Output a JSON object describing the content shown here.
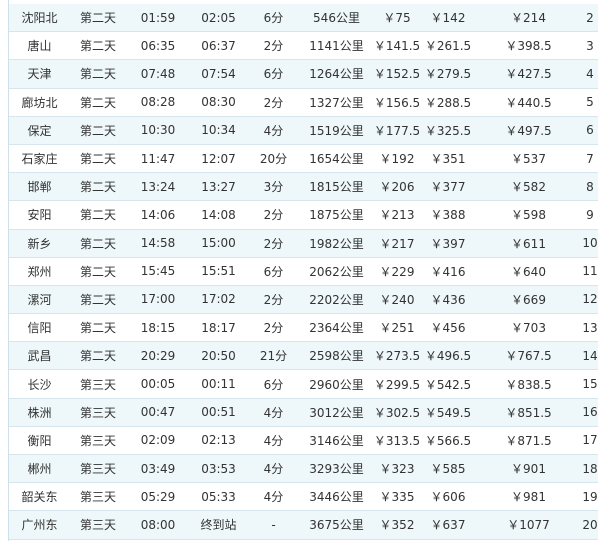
{
  "rows": [
    {
      "station": "沈阳北",
      "day": "第二天",
      "arrive": "01:59",
      "depart": "02:05",
      "stop": "6分",
      "distance": "546公里",
      "fare1": "￥75",
      "fare2": "￥142",
      "fare3": "￥214",
      "no": "2"
    },
    {
      "station": "唐山",
      "day": "第二天",
      "arrive": "06:35",
      "depart": "06:37",
      "stop": "2分",
      "distance": "1141公里",
      "fare1": "￥141.5",
      "fare2": "￥261.5",
      "fare3": "￥398.5",
      "no": "3"
    },
    {
      "station": "天津",
      "day": "第二天",
      "arrive": "07:48",
      "depart": "07:54",
      "stop": "6分",
      "distance": "1264公里",
      "fare1": "￥152.5",
      "fare2": "￥279.5",
      "fare3": "￥427.5",
      "no": "4"
    },
    {
      "station": "廊坊北",
      "day": "第二天",
      "arrive": "08:28",
      "depart": "08:30",
      "stop": "2分",
      "distance": "1327公里",
      "fare1": "￥156.5",
      "fare2": "￥288.5",
      "fare3": "￥440.5",
      "no": "5"
    },
    {
      "station": "保定",
      "day": "第二天",
      "arrive": "10:30",
      "depart": "10:34",
      "stop": "4分",
      "distance": "1519公里",
      "fare1": "￥177.5",
      "fare2": "￥325.5",
      "fare3": "￥497.5",
      "no": "6"
    },
    {
      "station": "石家庄",
      "day": "第二天",
      "arrive": "11:47",
      "depart": "12:07",
      "stop": "20分",
      "distance": "1654公里",
      "fare1": "￥192",
      "fare2": "￥351",
      "fare3": "￥537",
      "no": "7"
    },
    {
      "station": "邯郸",
      "day": "第二天",
      "arrive": "13:24",
      "depart": "13:27",
      "stop": "3分",
      "distance": "1815公里",
      "fare1": "￥206",
      "fare2": "￥377",
      "fare3": "￥582",
      "no": "8"
    },
    {
      "station": "安阳",
      "day": "第二天",
      "arrive": "14:06",
      "depart": "14:08",
      "stop": "2分",
      "distance": "1875公里",
      "fare1": "￥213",
      "fare2": "￥388",
      "fare3": "￥598",
      "no": "9"
    },
    {
      "station": "新乡",
      "day": "第二天",
      "arrive": "14:58",
      "depart": "15:00",
      "stop": "2分",
      "distance": "1982公里",
      "fare1": "￥217",
      "fare2": "￥397",
      "fare3": "￥611",
      "no": "10"
    },
    {
      "station": "郑州",
      "day": "第二天",
      "arrive": "15:45",
      "depart": "15:51",
      "stop": "6分",
      "distance": "2062公里",
      "fare1": "￥229",
      "fare2": "￥416",
      "fare3": "￥640",
      "no": "11"
    },
    {
      "station": "漯河",
      "day": "第二天",
      "arrive": "17:00",
      "depart": "17:02",
      "stop": "2分",
      "distance": "2202公里",
      "fare1": "￥240",
      "fare2": "￥436",
      "fare3": "￥669",
      "no": "12"
    },
    {
      "station": "信阳",
      "day": "第二天",
      "arrive": "18:15",
      "depart": "18:17",
      "stop": "2分",
      "distance": "2364公里",
      "fare1": "￥251",
      "fare2": "￥456",
      "fare3": "￥703",
      "no": "13"
    },
    {
      "station": "武昌",
      "day": "第二天",
      "arrive": "20:29",
      "depart": "20:50",
      "stop": "21分",
      "distance": "2598公里",
      "fare1": "￥273.5",
      "fare2": "￥496.5",
      "fare3": "￥767.5",
      "no": "14"
    },
    {
      "station": "长沙",
      "day": "第三天",
      "arrive": "00:05",
      "depart": "00:11",
      "stop": "6分",
      "distance": "2960公里",
      "fare1": "￥299.5",
      "fare2": "￥542.5",
      "fare3": "￥838.5",
      "no": "15"
    },
    {
      "station": "株洲",
      "day": "第三天",
      "arrive": "00:47",
      "depart": "00:51",
      "stop": "4分",
      "distance": "3012公里",
      "fare1": "￥302.5",
      "fare2": "￥549.5",
      "fare3": "￥851.5",
      "no": "16"
    },
    {
      "station": "衡阳",
      "day": "第三天",
      "arrive": "02:09",
      "depart": "02:13",
      "stop": "4分",
      "distance": "3146公里",
      "fare1": "￥313.5",
      "fare2": "￥566.5",
      "fare3": "￥871.5",
      "no": "17"
    },
    {
      "station": "郴州",
      "day": "第三天",
      "arrive": "03:49",
      "depart": "03:53",
      "stop": "4分",
      "distance": "3293公里",
      "fare1": "￥323",
      "fare2": "￥585",
      "fare3": "￥901",
      "no": "18"
    },
    {
      "station": "韶关东",
      "day": "第三天",
      "arrive": "05:29",
      "depart": "05:33",
      "stop": "4分",
      "distance": "3446公里",
      "fare1": "￥335",
      "fare2": "￥606",
      "fare3": "￥981",
      "no": "19"
    },
    {
      "station": "广州东",
      "day": "第三天",
      "arrive": "08:00",
      "depart": "终到站",
      "stop": "-",
      "distance": "3675公里",
      "fare1": "￥352",
      "fare2": "￥637",
      "fare3": "￥1077",
      "no": "20"
    }
  ]
}
